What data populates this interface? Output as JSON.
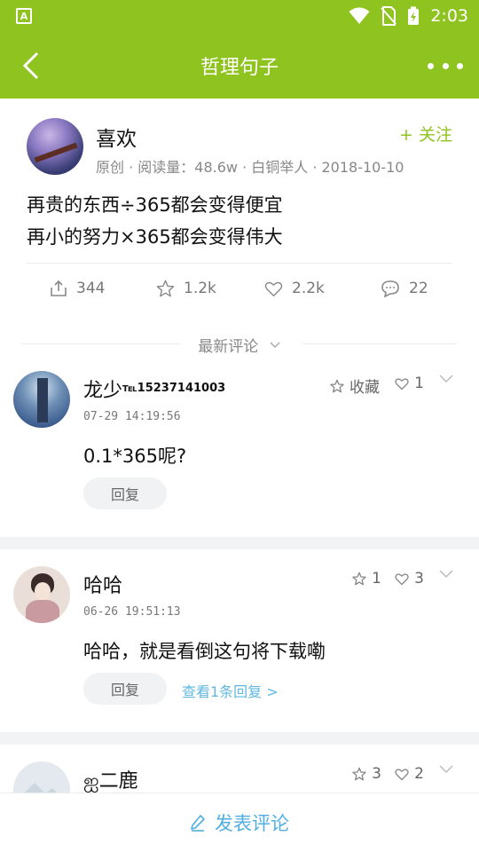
{
  "status_bar": {
    "time": "2:03",
    "app_icon_letter": "A"
  },
  "app_bar": {
    "title": "哲理句子",
    "back_icon": "chevron-left-icon",
    "more_icon": "more-dots-icon"
  },
  "post": {
    "author": "喜欢",
    "follow_label": "+ 关注",
    "meta": "原创 · 阅读量：48.6w · 白铜举人 · 2018-10-10",
    "body_line1": "再贵的东西÷365都会变得便宜",
    "body_line2": "再小的努力×365都会变得伟大",
    "actions": {
      "share": "344",
      "favorite": "1.2k",
      "like": "2.2k",
      "comment": "22"
    }
  },
  "section": {
    "title": "最新评论"
  },
  "comments": [
    {
      "name": "龙少",
      "name_suffix": "℡15237141003",
      "time": "07-29 14:19:56",
      "text": "0.1*365呢?",
      "collect_label": "收藏",
      "like_count": "1",
      "reply_label": "回复"
    },
    {
      "name": "哈哈",
      "time": "06-26 19:51:13",
      "text": "哈哈，就是看倒这句将下载嘞",
      "star_count": "1",
      "like_count": "3",
      "reply_label": "回复",
      "view_replies": "查看1条回复 >"
    },
    {
      "name": "ஐ二鹿",
      "star_count": "3",
      "like_count": "2"
    }
  ],
  "bottom_bar": {
    "label": "发表评论"
  },
  "colors": {
    "accent": "#8fc31f",
    "link": "#50aee0"
  }
}
